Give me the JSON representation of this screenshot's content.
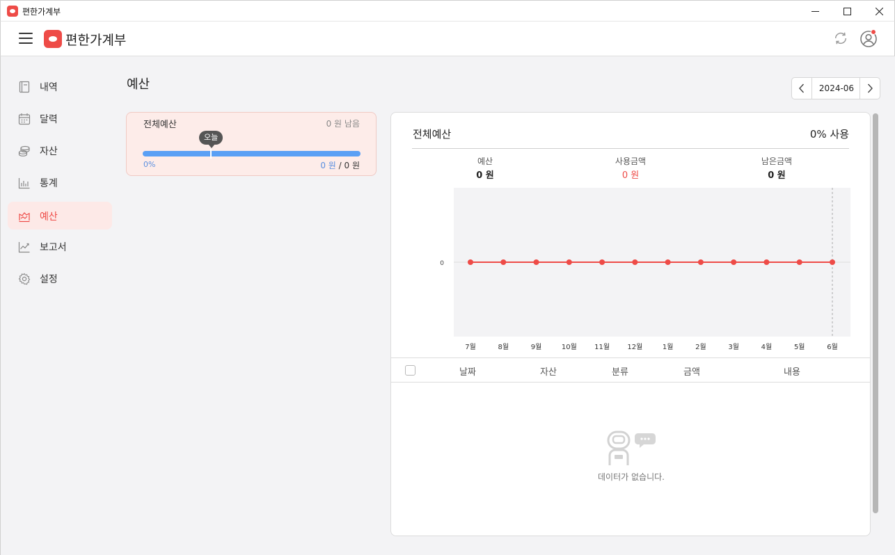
{
  "window": {
    "title": "편한가계부"
  },
  "header": {
    "app_name": "편한가계부",
    "menu_icon": "hamburger-icon",
    "refresh_icon": "refresh-icon",
    "profile_icon": "user-circle-icon",
    "notification_color": "#ee4b47"
  },
  "sidebar": {
    "items": [
      {
        "label": "내역",
        "icon": "book-icon"
      },
      {
        "label": "달력",
        "icon": "calendar-icon"
      },
      {
        "label": "자산",
        "icon": "coins-icon"
      },
      {
        "label": "통계",
        "icon": "bar-chart-icon"
      },
      {
        "label": "예산",
        "icon": "budget-icon",
        "active": true
      },
      {
        "label": "보고서",
        "icon": "line-chart-icon"
      },
      {
        "label": "설정",
        "icon": "gear-icon"
      }
    ]
  },
  "main": {
    "title": "예산",
    "month": "2024-06"
  },
  "budget_card": {
    "name": "전체예산",
    "remaining": "0 원 남음",
    "today_label": "오늘",
    "percent": "0%",
    "used": "0 원",
    "separator": " / ",
    "total": "0 원"
  },
  "detail": {
    "title": "전체예산",
    "usage": "0% 사용",
    "stats": [
      {
        "label": "예산",
        "value": "0 원"
      },
      {
        "label": "사용금액",
        "value": "0 원"
      },
      {
        "label": "남은금액",
        "value": "0 원"
      }
    ],
    "table": {
      "columns": [
        "날짜",
        "자산",
        "분류",
        "금액",
        "내용"
      ]
    },
    "empty_message": "데이터가 없습니다."
  },
  "colors": {
    "accent": "#ee4b47",
    "progress": "#5aa0f5",
    "active_bg": "#fde9e7"
  },
  "chart_data": {
    "type": "line",
    "categories": [
      "7월",
      "8월",
      "9월",
      "10월",
      "11월",
      "12월",
      "1월",
      "2월",
      "3월",
      "4월",
      "5월",
      "6월"
    ],
    "series": [
      {
        "values": [
          0,
          0,
          0,
          0,
          0,
          0,
          0,
          0,
          0,
          0,
          0,
          0
        ],
        "color": "#ee4b47"
      }
    ],
    "yticks": [
      0
    ],
    "grid": false,
    "legend": "none",
    "current_month_marker": "6월"
  }
}
